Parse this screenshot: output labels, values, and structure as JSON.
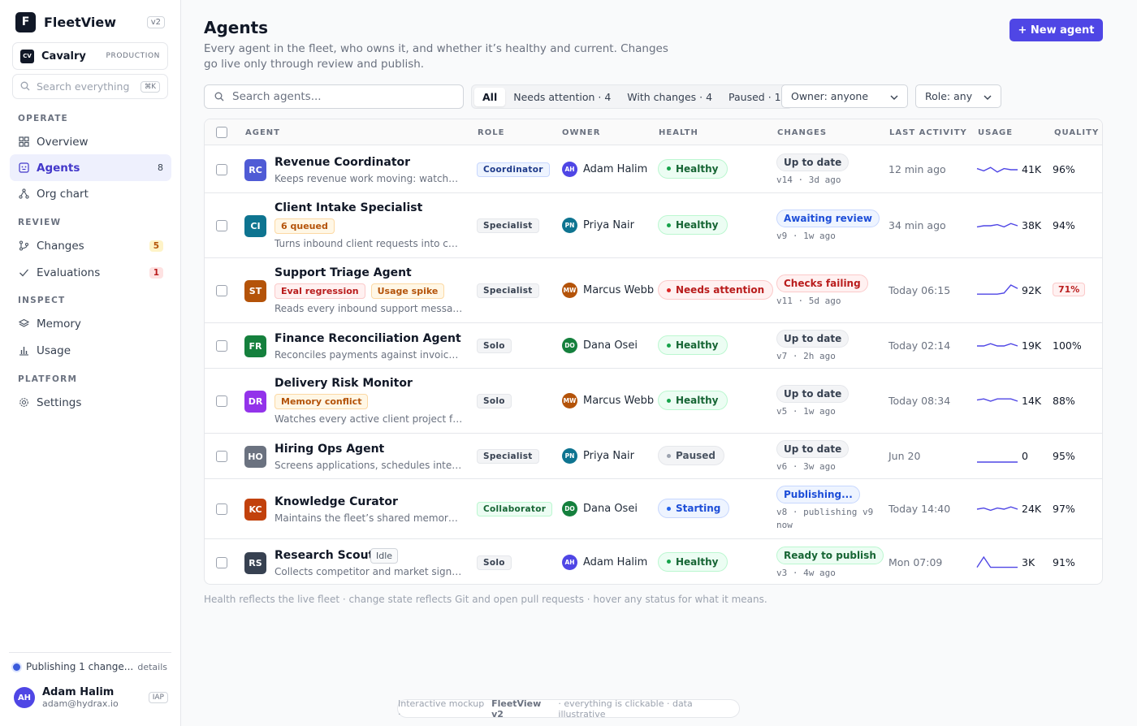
{
  "app": {
    "name": "FleetView",
    "version": "v2",
    "logo_letter": "F",
    "accent": "#4f46e5"
  },
  "workspace": {
    "initials": "CV",
    "name": "Cavalry",
    "env": "PRODUCTION"
  },
  "sidebar": {
    "search_placeholder": "Search everything",
    "search_shortcut": "⌘K",
    "sections": [
      {
        "title": "OPERATE",
        "items": [
          {
            "label": "Overview",
            "icon": "grid-icon"
          },
          {
            "label": "Agents",
            "icon": "agent-icon",
            "count": "8",
            "active": true
          },
          {
            "label": "Org chart",
            "icon": "org-chart-icon"
          }
        ]
      },
      {
        "title": "REVIEW",
        "items": [
          {
            "label": "Changes",
            "icon": "branch-icon",
            "badge": "5"
          },
          {
            "label": "Evaluations",
            "icon": "check-icon",
            "badge": "1"
          }
        ]
      },
      {
        "title": "INSPECT",
        "items": [
          {
            "label": "Memory",
            "icon": "layers-icon"
          },
          {
            "label": "Usage",
            "icon": "bar-chart-icon"
          }
        ]
      },
      {
        "title": "PLATFORM",
        "items": [
          {
            "label": "Settings",
            "icon": "gear-icon"
          }
        ]
      }
    ],
    "publishing": {
      "text": "Publishing 1 change...",
      "link": "details"
    },
    "user": {
      "initials": "AH",
      "name": "Adam Halim",
      "email": "adam@hydrax.io",
      "tag": "IAP"
    }
  },
  "header": {
    "title": "Agents",
    "subtitle": "Every agent in the fleet, who owns it, and whether it’s healthy and current. Changes go live only through review and publish.",
    "new_button": "+ New agent"
  },
  "toolbar": {
    "search_placeholder": "Search agents...",
    "filters": [
      "All",
      "Needs attention · 4",
      "With changes · 4",
      "Paused · 1"
    ],
    "owner_select": "Owner: anyone",
    "role_select": "Role: any"
  },
  "table": {
    "columns": [
      "AGENT",
      "ROLE",
      "OWNER",
      "HEALTH",
      "CHANGES",
      "LAST ACTIVITY",
      "USAGE",
      "QUALITY"
    ],
    "rows": [
      {
        "initials": "RC",
        "color": "#4f5bd5",
        "name": "Revenue Coordinator",
        "desc": "Keeps revenue work moving: watches re...",
        "chips": [],
        "role": "Coordinator",
        "owner": "Adam Halim",
        "owner_initials": "AH",
        "owner_color": "#4f46e5",
        "health": "Healthy",
        "change": "Up to date",
        "change_meta": "v14 · 3d ago",
        "activity": "12 min ago",
        "usage": "41K",
        "quality": "96%",
        "spark": [
          6,
          4,
          7,
          3,
          6,
          5,
          5
        ]
      },
      {
        "initials": "CI",
        "color": "#0e7490",
        "name": "Client Intake Specialist",
        "desc": "Turns inbound client requests into compl...",
        "chips": [
          "6 queued"
        ],
        "role": "Specialist",
        "owner": "Priya Nair",
        "owner_initials": "PN",
        "owner_color": "#0e7490",
        "health": "Healthy",
        "change": "Awaiting review",
        "change_meta": "v9 · 1w ago",
        "activity": "34 min ago",
        "usage": "38K",
        "quality": "94%",
        "spark": [
          4,
          5,
          5,
          6,
          4,
          7,
          5
        ]
      },
      {
        "initials": "ST",
        "color": "#b45309",
        "name": "Support Triage Agent",
        "desc": "Reads every inbound support message, ...",
        "chips": [
          "Eval regression",
          "Usage spike"
        ],
        "role": "Specialist",
        "owner": "Marcus Webb",
        "owner_initials": "MW",
        "owner_color": "#b45309",
        "health": "Needs attention",
        "change": "Checks failing",
        "change_meta": "v11 · 5d ago",
        "activity": "Today 06:15",
        "usage": "92K",
        "quality": "71%",
        "spark": [
          2,
          2,
          2,
          2,
          3,
          10,
          7
        ]
      },
      {
        "initials": "FR",
        "color": "#15803d",
        "name": "Finance Reconciliation Agent",
        "desc": "Reconciles payments against invoices ev...",
        "chips": [],
        "role": "Solo",
        "owner": "Dana Osei",
        "owner_initials": "DO",
        "owner_color": "#15803d",
        "health": "Healthy",
        "change": "Up to date",
        "change_meta": "v7 · 2h ago",
        "activity": "Today 02:14",
        "usage": "19K",
        "quality": "100%",
        "spark": [
          5,
          5,
          7,
          5,
          5,
          7,
          5
        ]
      },
      {
        "initials": "DR",
        "color": "#9333ea",
        "name": "Delivery Risk Monitor",
        "desc": "Watches every active client project for sl...",
        "chips": [
          "Memory conflict"
        ],
        "role": "Solo",
        "owner": "Marcus Webb",
        "owner_initials": "MW",
        "owner_color": "#b45309",
        "health": "Healthy",
        "change": "Up to date",
        "change_meta": "v5 · 1w ago",
        "activity": "Today 08:34",
        "usage": "14K",
        "quality": "88%",
        "spark": [
          6,
          7,
          5,
          7,
          7,
          7,
          5
        ]
      },
      {
        "initials": "HO",
        "color": "#6b7280",
        "name": "Hiring Ops Agent",
        "desc": "Screens applications, schedules intervie...",
        "chips": [],
        "role": "Specialist",
        "owner": "Priya Nair",
        "owner_initials": "PN",
        "owner_color": "#0e7490",
        "health": "Paused",
        "change": "Up to date",
        "change_meta": "v6 · 3w ago",
        "activity": "Jun 20",
        "usage": "0",
        "quality": "95%",
        "spark": [
          0,
          0,
          0,
          0,
          0,
          0,
          0
        ]
      },
      {
        "initials": "KC",
        "color": "#c2410c",
        "name": "Knowledge Curator",
        "desc": "Maintains the fleet’s shared memory: rev...",
        "chips": [],
        "role": "Collaborator",
        "owner": "Dana Osei",
        "owner_initials": "DO",
        "owner_color": "#15803d",
        "health": "Starting",
        "change": "Publishing...",
        "change_meta": "v8 · publishing v9 now",
        "activity": "Today 14:40",
        "usage": "24K",
        "quality": "97%",
        "spark": [
          5,
          6,
          4,
          6,
          5,
          7,
          5
        ]
      },
      {
        "initials": "RS",
        "color": "#374151",
        "name": "Research Scout",
        "desc": "Collects competitor and market signals f...",
        "chips": [],
        "idle": "Idle",
        "role": "Solo",
        "owner": "Adam Halim",
        "owner_initials": "AH",
        "owner_color": "#4f46e5",
        "health": "Healthy",
        "change": "Ready to publish",
        "change_meta": "v3 · 4w ago",
        "activity": "Mon 07:09",
        "usage": "3K",
        "quality": "91%",
        "spark": [
          1,
          10,
          1,
          1,
          1,
          1,
          1
        ]
      }
    ]
  },
  "footnote": "Health reflects the live fleet · change state reflects Git and open pull requests · hover any status for what it means.",
  "mockup_pill": {
    "pre": "Interactive mockup ·",
    "brand": "FleetView v2",
    "post": "· everything is clickable · data illustrative"
  }
}
